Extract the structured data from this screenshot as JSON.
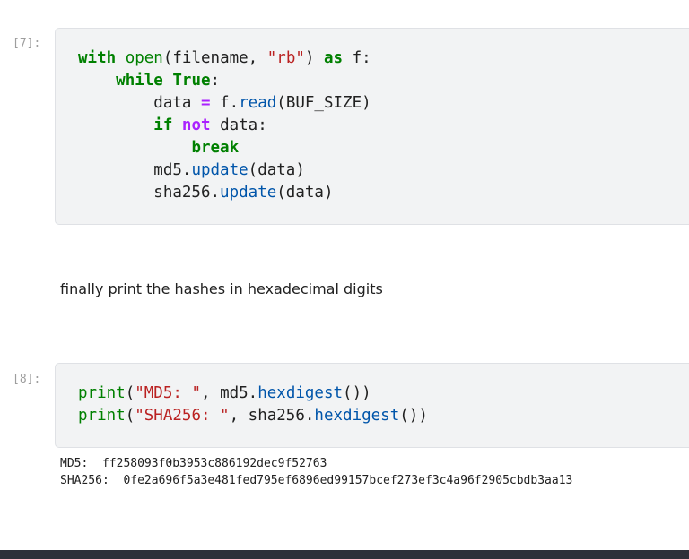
{
  "cells": [
    {
      "prompt": "[7]:",
      "code": [
        [
          {
            "t": "with",
            "c": "kw"
          },
          {
            "t": " "
          },
          {
            "t": "open",
            "c": "bi"
          },
          {
            "t": "(filename, "
          },
          {
            "t": "\"rb\"",
            "c": "str"
          },
          {
            "t": ") "
          },
          {
            "t": "as",
            "c": "kw"
          },
          {
            "t": " f:"
          }
        ],
        [
          {
            "t": "    "
          },
          {
            "t": "while",
            "c": "kw"
          },
          {
            "t": " "
          },
          {
            "t": "True",
            "c": "kw"
          },
          {
            "t": ":"
          }
        ],
        [
          {
            "t": "        data "
          },
          {
            "t": "=",
            "c": "op"
          },
          {
            "t": " f."
          },
          {
            "t": "read",
            "c": "fn"
          },
          {
            "t": "(BUF_SIZE)"
          }
        ],
        [
          {
            "t": "        "
          },
          {
            "t": "if",
            "c": "kw"
          },
          {
            "t": " "
          },
          {
            "t": "not",
            "c": "op"
          },
          {
            "t": " data:"
          }
        ],
        [
          {
            "t": "            "
          },
          {
            "t": "break",
            "c": "kw"
          }
        ],
        [
          {
            "t": "        md5."
          },
          {
            "t": "update",
            "c": "fn"
          },
          {
            "t": "(data)"
          }
        ],
        [
          {
            "t": "        sha256."
          },
          {
            "t": "update",
            "c": "fn"
          },
          {
            "t": "(data)"
          }
        ]
      ]
    },
    {
      "prompt": "[8]:",
      "code": [
        [
          {
            "t": "print",
            "c": "bi"
          },
          {
            "t": "("
          },
          {
            "t": "\"MD5: \"",
            "c": "str"
          },
          {
            "t": ", md5."
          },
          {
            "t": "hexdigest",
            "c": "fn"
          },
          {
            "t": "())"
          }
        ],
        [
          {
            "t": "print",
            "c": "bi"
          },
          {
            "t": "("
          },
          {
            "t": "\"SHA256: \"",
            "c": "str"
          },
          {
            "t": ", sha256."
          },
          {
            "t": "hexdigest",
            "c": "fn"
          },
          {
            "t": "())"
          }
        ]
      ]
    }
  ],
  "markdown_text": "finally print the hashes in hexadecimal digits",
  "output_lines": [
    "MD5:  ff258093f0b3953c886192dec9f52763",
    "SHA256:  0fe2a696f5a3e481fed795ef6896ed99157bcef273ef3c4a96f2905cbdb3aa13"
  ],
  "colors": {
    "keyword": "#008000",
    "string": "#ba2121",
    "operator": "#aa22ff",
    "method": "#0055aa",
    "cell_background": "#f2f3f4"
  }
}
